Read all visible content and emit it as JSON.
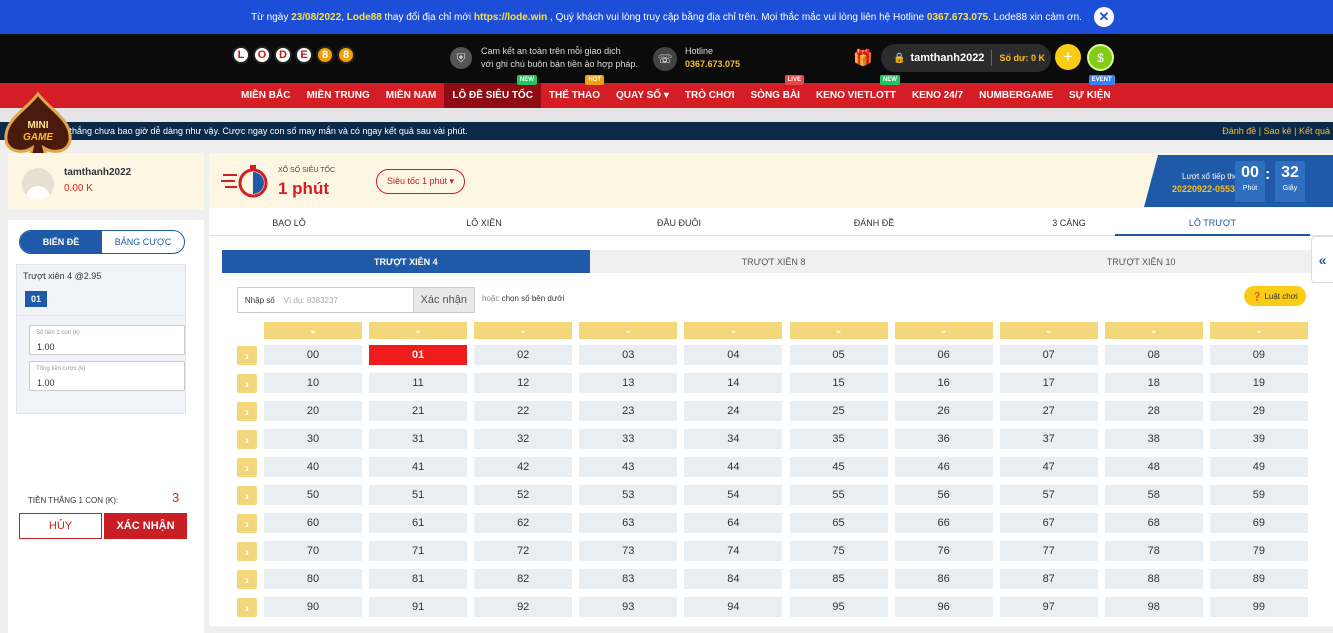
{
  "notice": {
    "text_1": "Từ ngày ",
    "date": "23/08/2022",
    "text_2": ", ",
    "brand": "Lode88",
    "text_3": " thay đổi địa chỉ mới ",
    "url": "https://lode.win",
    "text_4": " , Quý khách vui lòng truy cập bằng địa chỉ trên. Mọi thắc mắc vui lòng liên hệ Hotline ",
    "hotline": "0367.673.075",
    "text_5": ". Lode88 xin cảm ơn.",
    "close": "✕"
  },
  "header": {
    "logo_letters": [
      "L",
      "O",
      "D",
      "E",
      "8",
      "8"
    ],
    "safe_line1": "Cam kết an toàn trên mỗi giao dịch",
    "safe_line2": "với ghi chú buôn bán tiền ảo hợp pháp.",
    "hotline_label": "Hotline",
    "hotline_number": "0367.673.075",
    "username": "tamthanh2022",
    "balance": "Số dư: 0 K",
    "plus": "+",
    "money_glyph": "$",
    "gift_glyph": "🎁",
    "lock_glyph": "🔒"
  },
  "nav": [
    {
      "label": "MIỀN BẮC",
      "badge": ""
    },
    {
      "label": "MIỀN TRUNG",
      "badge": ""
    },
    {
      "label": "MIỀN NAM",
      "badge": ""
    },
    {
      "label": "LÔ ĐỀ SIÊU TỐC",
      "badge": "NEW"
    },
    {
      "label": "THỂ THAO",
      "badge": "HOT"
    },
    {
      "label": "QUAY SỐ ▾",
      "badge": ""
    },
    {
      "label": "TRÒ CHƠI",
      "badge": ""
    },
    {
      "label": "SÒNG BÀI",
      "badge": "LIVE"
    },
    {
      "label": "KENO VIETLOTT",
      "badge": "NEW"
    },
    {
      "label": "KENO 24/7",
      "badge": ""
    },
    {
      "label": "NUMBERGAME",
      "badge": ""
    },
    {
      "label": "SỰ KIỆN",
      "badge": "EVENT"
    }
  ],
  "ticker": {
    "text": "n thắng chưa bao giờ dễ dàng như vậy. Cược ngay con số may mắn và có ngay kết quả sau vài phút.",
    "links": "Đánh đề | Sao kê | Kết quả"
  },
  "minigame": {
    "line1": "MINI",
    "line2": "GAME"
  },
  "usercard": {
    "name": "tamthanh2022",
    "balance": "0.00 K"
  },
  "betslip": {
    "tab_bet": "BIẾN ĐỀ",
    "tab_table": "BẢNG CƯỢC",
    "header": "Trượt xiên 4 @2.95",
    "picked": "01",
    "amount_label": "Số tiền 1 con (k)",
    "amount_value": "1.00",
    "total_label": "Tổng tiền cược (k)",
    "total_value": "1.00",
    "win_label": "TIỀN THẮNG 1 CON (K):",
    "win_value": "3",
    "cancel": "HỦY",
    "confirm": "XÁC NHẬN"
  },
  "game": {
    "subtitle": "XỔ SỐ SIÊU TỐC",
    "title": "1 phút",
    "speed_select": "Siêu tốc 1 phút ▾",
    "next_label": "Lượt xổ tiếp theo",
    "next_id": "20220922-0553",
    "minutes": "00",
    "minutes_unit": "Phút",
    "seconds": "32",
    "seconds_unit": "Giây"
  },
  "bet_tabs": [
    "BAO LÔ",
    "LÔ XIÊN",
    "ĐẦU ĐUÔI",
    "ĐÁNH ĐỀ",
    "3 CÀNG",
    "LÔ TRƯỢT"
  ],
  "bet_tab_active": 5,
  "sub_tabs": [
    "TRƯỢT XIÊN 4",
    "TRƯỢT XIÊN 8",
    "TRƯỢT XIÊN 10"
  ],
  "sub_tab_active": 0,
  "number_input": {
    "label": "Nhập số",
    "placeholder": "Ví dụ: 8383237",
    "button": "Xác nhận",
    "or_text": "hoặc",
    "pick_text": "chọn số bên dưới"
  },
  "rules_button": "❓ Luật chơi",
  "grid": {
    "col_glyph": "⌄",
    "row_glyph": "›",
    "selected": [
      "01"
    ]
  },
  "collapse_glyph": "«"
}
